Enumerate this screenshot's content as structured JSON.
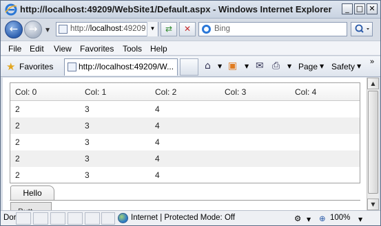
{
  "window": {
    "title": "http://localhost:49209/WebSite1/Default.aspx - Windows Internet Explorer",
    "buttons": {
      "minimize": "_",
      "maximize": "□",
      "close": "✕"
    }
  },
  "address": {
    "url_prefix": "http://",
    "url_host": "localhost",
    "url_rest": ":49209",
    "search_placeholder": "Bing"
  },
  "menu": [
    "File",
    "Edit",
    "View",
    "Favorites",
    "Tools",
    "Help"
  ],
  "favorites": {
    "label": "Favorites",
    "tab_title": "http://localhost:49209/W..."
  },
  "commandbar": {
    "page": "Page",
    "safety": "Safety"
  },
  "grid": {
    "columns": [
      "Col: 0",
      "Col: 1",
      "Col: 2",
      "Col: 3",
      "Col: 4"
    ],
    "rows": [
      [
        "2",
        "3",
        "4",
        "",
        ""
      ],
      [
        "2",
        "3",
        "4",
        "",
        ""
      ],
      [
        "2",
        "3",
        "4",
        "",
        ""
      ],
      [
        "2",
        "3",
        "4",
        "",
        ""
      ],
      [
        "2",
        "3",
        "4",
        "",
        ""
      ]
    ]
  },
  "tabs": {
    "active": "Hello",
    "partial": "Butt"
  },
  "status": {
    "left": "Dor",
    "zone": "Internet | Protected Mode: Off",
    "zoom": "100%"
  }
}
